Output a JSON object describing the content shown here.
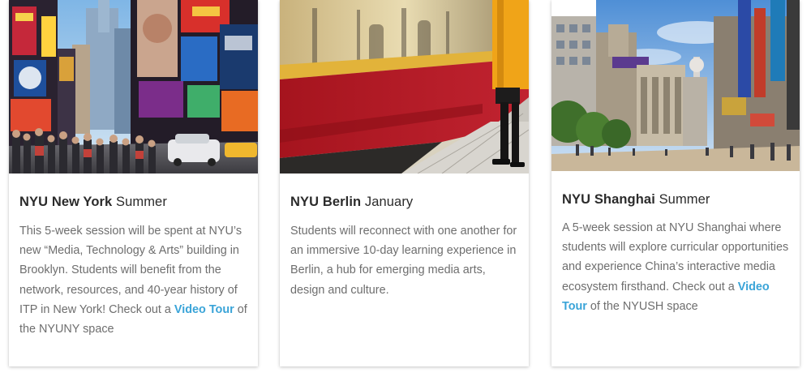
{
  "cards": [
    {
      "title_strong": "NYU New York",
      "title_rest": " Summer",
      "desc_before": "This 5-week session will be spent at NYU’s new “Media, Technology & Arts” building in Brooklyn. Students will benefit from the network, resources, and 40-year history of ITP in New York! Check out a ",
      "link_label": "Video Tour",
      "desc_after": " of the NYUNY space",
      "image": "times-square-photo"
    },
    {
      "title_strong": "NYU Berlin",
      "title_rest": " January",
      "desc": "Students will reconnect with one another for an immersive 10-day learning experience in Berlin, a hub for emerging media arts, design and culture.",
      "image": "berlin-train-photo"
    },
    {
      "title_strong": "NYU Shanghai",
      "title_rest": " Summer",
      "desc_before": "A 5-week session at NYU Shanghai where students will explore curricular opportunities and experience China’s interactive media ecosystem firsthand. Check out a ",
      "link_label": "Video Tour",
      "desc_after": " of the NYUSH space",
      "image": "shanghai-street-photo"
    }
  ],
  "colors": {
    "link": "#3aa4d8",
    "title": "#2b2b2b",
    "body_text": "#6e6e6e"
  }
}
